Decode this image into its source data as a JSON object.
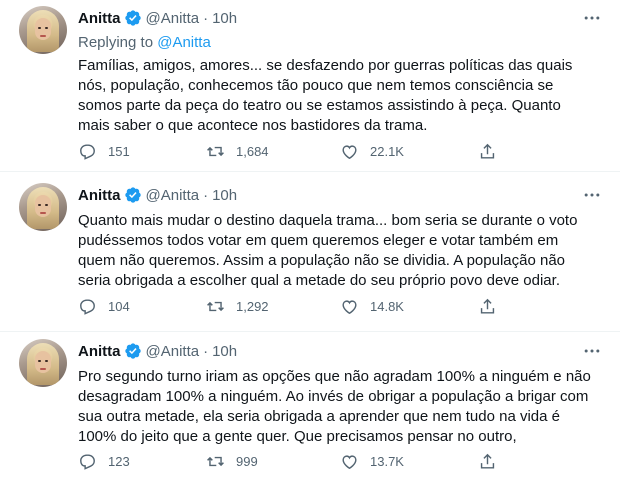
{
  "tweets": [
    {
      "name": "Anitta",
      "handle": "@Anitta",
      "separator": "·",
      "time": "10h",
      "replying_prefix": "Replying to",
      "replying_to": "@Anitta",
      "text": "Famílias, amigos, amores... se desfazendo por guerras políticas das quais\nnós, população, conhecemos tão pouco que nem temos consciência se\nsomos parte da peça do teatro ou se estamos assistindo à peça. Quanto\nmais saber o que acontece nos bastidores da trama.",
      "replies": "151",
      "retweets": "1,684",
      "likes": "22.1K"
    },
    {
      "name": "Anitta",
      "handle": "@Anitta",
      "separator": "·",
      "time": "10h",
      "text": "Quanto mais mudar o destino daquela trama... bom seria se durante o voto\npudéssemos todos votar em quem queremos eleger e votar também em\nquem não queremos. Assim a população não se dividia. A população não\nseria obrigada a escolher qual a metade do seu próprio povo deve odiar.",
      "replies": "104",
      "retweets": "1,292",
      "likes": "14.8K"
    },
    {
      "name": "Anitta",
      "handle": "@Anitta",
      "separator": "·",
      "time": "10h",
      "text": "Pro segundo turno iriam as opções que não agradam 100% a ninguém e não\ndesagradam 100% a ninguém. Ao invés de obrigar a população a brigar com\nsua outra metade, ela seria obrigada a aprender que nem tudo na vida é\n100% do jeito que a gente quer. Que precisamos pensar no outro,",
      "replies": "123",
      "retweets": "999",
      "likes": "13.7K"
    }
  ],
  "icons": {
    "verified": "verified-badge-icon",
    "more": "more-horizontal-icon",
    "reply": "reply-icon",
    "retweet": "retweet-icon",
    "like": "like-heart-icon",
    "share": "share-icon"
  },
  "colors": {
    "text": "#0f1419",
    "secondary": "#536471",
    "accent": "#1d9bf0",
    "divider": "#eff3f4"
  }
}
